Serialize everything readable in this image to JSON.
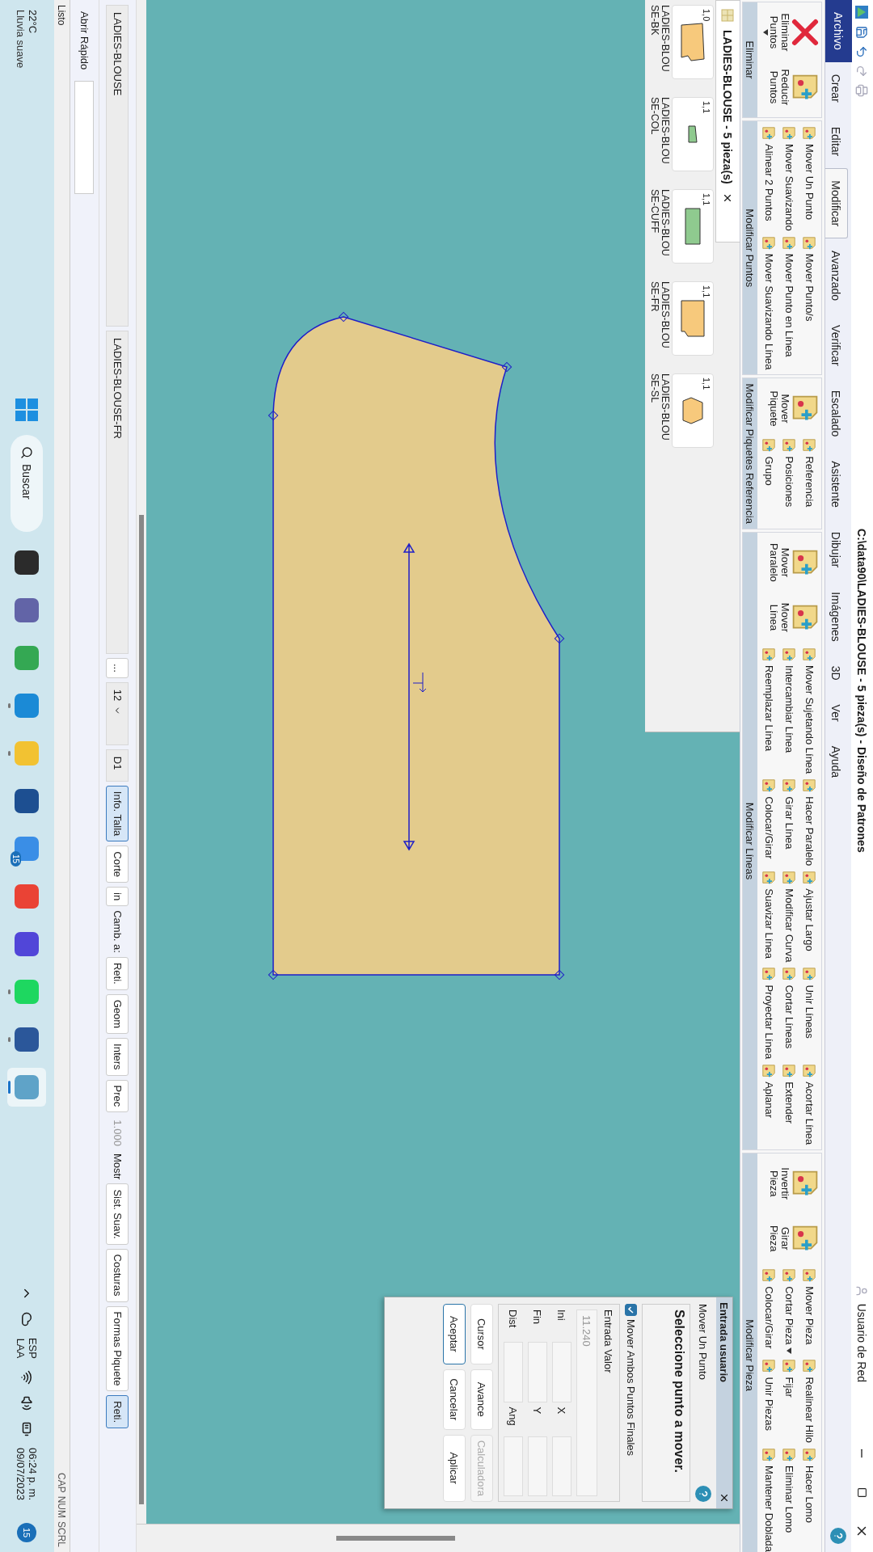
{
  "title_bar": {
    "title": "C:\\data90\\LADIES-BLOUSE - 5 pieza(s) - Diseño de Patrones",
    "user": "Usuario de Red"
  },
  "ribbon_tabs": [
    {
      "label": "Archivo",
      "kind": "file",
      "selected": false
    },
    {
      "label": "Crear",
      "kind": "tab",
      "selected": false
    },
    {
      "label": "Editar",
      "kind": "tab",
      "selected": false
    },
    {
      "label": "Modificar",
      "kind": "tab",
      "selected": true
    },
    {
      "label": "Avanzado",
      "kind": "tab",
      "selected": false
    },
    {
      "label": "Verificar",
      "kind": "tab",
      "selected": false
    },
    {
      "label": "Escalado",
      "kind": "tab",
      "selected": false
    },
    {
      "label": "Asistente",
      "kind": "tab",
      "selected": false
    },
    {
      "label": "Dibujar",
      "kind": "tab",
      "selected": false
    },
    {
      "label": "Imágenes",
      "kind": "tab",
      "selected": false
    },
    {
      "label": "3D",
      "kind": "tab",
      "selected": false
    },
    {
      "label": "Ver",
      "kind": "tab",
      "selected": false
    },
    {
      "label": "Ayuda",
      "kind": "tab",
      "selected": false
    }
  ],
  "ribbon_groups": [
    {
      "label": "Eliminar",
      "big": [
        {
          "label": "Eliminar Puntos",
          "dropdown": true
        },
        {
          "label": "Reducir Puntos",
          "dropdown": false
        }
      ]
    },
    {
      "label": "Modificar Puntos",
      "columns": [
        [
          {
            "label": "Mover Un Punto",
            "dropdown": false
          },
          {
            "label": "Mover Suavizando",
            "dropdown": false
          },
          {
            "label": "Alinear 2 Puntos",
            "dropdown": false
          }
        ],
        [
          {
            "label": "Mover Punto/s",
            "dropdown": false
          },
          {
            "label": "Mover Punto en Línea",
            "dropdown": false
          },
          {
            "label": "Mover Suavizando Línea",
            "dropdown": false
          }
        ]
      ]
    },
    {
      "label": "Modificar Piquetes Referencia",
      "big": [
        {
          "label": "Mover Piquete",
          "dropdown": false
        }
      ],
      "columns": [
        [
          {
            "label": "Referencia",
            "dropdown": false
          },
          {
            "label": "Posiciones",
            "dropdown": false
          },
          {
            "label": "Grupo",
            "dropdown": false
          }
        ]
      ]
    },
    {
      "label": "Modificar Líneas",
      "big": [
        {
          "label": "Mover Paralelo",
          "dropdown": false
        },
        {
          "label": "Mover Línea",
          "dropdown": false
        }
      ],
      "columns": [
        [
          {
            "label": "Mover Sujetando Línea",
            "dropdown": false
          },
          {
            "label": "Intercambiar Línea",
            "dropdown": false
          },
          {
            "label": "Reemplazar Línea",
            "dropdown": false
          }
        ],
        [
          {
            "label": "Hacer Paralelo",
            "dropdown": false
          },
          {
            "label": "Girar Línea",
            "dropdown": false
          },
          {
            "label": "Colocar/Girar",
            "dropdown": false
          }
        ],
        [
          {
            "label": "Ajustar Largo",
            "dropdown": false
          },
          {
            "label": "Modificar Curva",
            "dropdown": false
          },
          {
            "label": "Suavizar Línea",
            "dropdown": false
          }
        ],
        [
          {
            "label": "Unir Líneas",
            "dropdown": false
          },
          {
            "label": "Cortar Líneas",
            "dropdown": false
          },
          {
            "label": "Proyectar Línea",
            "dropdown": false
          }
        ],
        [
          {
            "label": "Acortar Línea",
            "dropdown": false
          },
          {
            "label": "Extender",
            "dropdown": false
          },
          {
            "label": "Aplanar",
            "dropdown": false
          }
        ]
      ]
    },
    {
      "label": "Modificar Pieza",
      "big": [
        {
          "label": "Invertir Pieza",
          "dropdown": false
        },
        {
          "label": "Girar Pieza",
          "dropdown": false
        }
      ],
      "columns": [
        [
          {
            "label": "Mover Pieza",
            "dropdown": false
          },
          {
            "label": "Cortar Pieza",
            "dropdown": true
          },
          {
            "label": "Colocar/Girar",
            "dropdown": false
          }
        ],
        [
          {
            "label": "Realinear Hilo",
            "dropdown": false
          },
          {
            "label": "Fijar",
            "dropdown": false
          },
          {
            "label": "Unir Piezas",
            "dropdown": false
          }
        ],
        [
          {
            "label": "Hacer Lomo",
            "dropdown": false
          },
          {
            "label": "Eliminar Lomo",
            "dropdown": false
          },
          {
            "label": "Mantener Doblada",
            "dropdown": false
          }
        ]
      ]
    }
  ],
  "document_tab": {
    "label": "LADIES-BLOUSE - 5 pieza(s)"
  },
  "pieces": [
    {
      "name": "LADIES-BLOUSE-BK",
      "size": "1,0",
      "kind": "bodice",
      "color": "#f7c97c"
    },
    {
      "name": "LADIES-BLOUSE-COL",
      "size": "1,1",
      "kind": "collar",
      "color": "#8fca8f"
    },
    {
      "name": "LADIES-BLOUSE-CUFF",
      "size": "1,1",
      "kind": "cuff",
      "color": "#8fca8f"
    },
    {
      "name": "LADIES-BLOUSE-FR",
      "size": "1,1",
      "kind": "front",
      "color": "#f7c97c"
    },
    {
      "name": "LADIES-BLOUSE-SL",
      "size": "1,1",
      "kind": "sleeve",
      "color": "#f7c97c"
    }
  ],
  "dialog": {
    "title": "Entrada usuario",
    "command": "Mover Un Punto",
    "prompt": "Seleccione punto a mover.",
    "option": {
      "label": "Mover Ambos Puntos Finales",
      "checked": true
    },
    "entry_label": "Entrada Valor",
    "entry_value": "11.240",
    "rows": [
      {
        "label": "Ini",
        "axis": "X"
      },
      {
        "label": "Fin",
        "axis": "Y"
      },
      {
        "label": "Dist",
        "axis": "Ang"
      }
    ],
    "buttons": [
      {
        "label": "Cursor",
        "disabled": false,
        "focused": false
      },
      {
        "label": "Avance",
        "disabled": false,
        "focused": false
      },
      {
        "label": "Calculadora",
        "disabled": true,
        "focused": false
      },
      {
        "label": "Aceptar",
        "disabled": false,
        "focused": true
      },
      {
        "label": "Cancelar",
        "disabled": false,
        "focused": false
      },
      {
        "label": "Aplicar",
        "disabled": false,
        "focused": false
      }
    ]
  },
  "bottom_toolbar": [
    {
      "kind": "field",
      "label": "LADIES-BLOUSE"
    },
    {
      "kind": "field",
      "label": "LADIES-BLOUSE-FR"
    },
    {
      "kind": "button",
      "label": "...",
      "selected": false
    },
    {
      "kind": "select",
      "label": "12"
    },
    {
      "kind": "select",
      "label": "D1"
    },
    {
      "kind": "button",
      "label": "Info. Talla",
      "selected": true
    },
    {
      "kind": "button",
      "label": "Corte",
      "selected": false
    },
    {
      "kind": "button",
      "label": "in",
      "selected": false
    },
    {
      "kind": "label",
      "label": "Camb. a:"
    },
    {
      "kind": "button",
      "label": "Reti.",
      "selected": false
    },
    {
      "kind": "button",
      "label": "Geom",
      "selected": false
    },
    {
      "kind": "button",
      "label": "Inters",
      "selected": false
    },
    {
      "kind": "button",
      "label": "Prec",
      "selected": false
    },
    {
      "kind": "readout",
      "label": "1.000"
    },
    {
      "kind": "label",
      "label": "Mostr"
    },
    {
      "kind": "button",
      "label": "Sist. Suav.",
      "selected": false
    },
    {
      "kind": "button",
      "label": "Costuras",
      "selected": false
    },
    {
      "kind": "button",
      "label": "Formas Piquete",
      "selected": false
    },
    {
      "kind": "button",
      "label": "Reti.",
      "selected": true
    }
  ],
  "quick_open": {
    "label": "Abrir Rápido"
  },
  "status_bar": {
    "text": "Listo",
    "indicators": [
      "CAP",
      "NUM",
      "SCRL"
    ]
  },
  "taskbar": {
    "weather": {
      "temperature": "22°C",
      "condition": "Lluvia suave"
    },
    "search": "Buscar",
    "apps": [
      {
        "color": "#2b2b2b",
        "running": false,
        "active": false
      },
      {
        "color": "#6264a7",
        "running": false,
        "active": false
      },
      {
        "color": "#34a853",
        "running": false,
        "active": false
      },
      {
        "color": "#1b8ad6",
        "running": true,
        "active": false
      },
      {
        "color": "#f2c232",
        "running": true,
        "active": false
      },
      {
        "color": "#1d4f91",
        "running": false,
        "active": false
      },
      {
        "color": "#3a8ee6",
        "running": false,
        "active": false,
        "badge": "15"
      },
      {
        "color": "#ea4335",
        "running": false,
        "active": false
      },
      {
        "color": "#5146d8",
        "running": false,
        "active": false
      },
      {
        "color": "#1ed760",
        "running": true,
        "active": false
      },
      {
        "color": "#2b579a",
        "running": true,
        "active": false
      },
      {
        "color": "#5fa3c8",
        "running": true,
        "active": true
      }
    ],
    "language": [
      "ESP",
      "LAA"
    ],
    "time": "06:24 p. m.",
    "date": "09/07/2023",
    "notifications": "15"
  }
}
